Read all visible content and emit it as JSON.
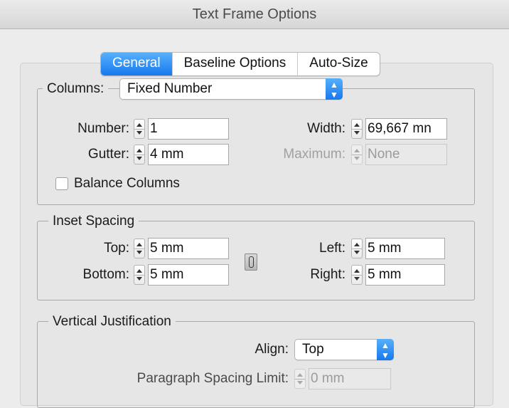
{
  "window": {
    "title": "Text Frame Options"
  },
  "tabs": [
    {
      "label": "General",
      "active": true
    },
    {
      "label": "Baseline Options",
      "active": false
    },
    {
      "label": "Auto-Size",
      "active": false
    }
  ],
  "columns": {
    "legend": "Columns:",
    "type_value": "Fixed Number",
    "number_label": "Number:",
    "number_value": "1",
    "width_label": "Width:",
    "width_value": "69,667 mn",
    "gutter_label": "Gutter:",
    "gutter_value": "4 mm",
    "maximum_label": "Maximum:",
    "maximum_value": "None",
    "balance_label": "Balance Columns"
  },
  "inset": {
    "legend": "Inset Spacing",
    "top_label": "Top:",
    "top_value": "5 mm",
    "bottom_label": "Bottom:",
    "bottom_value": "5 mm",
    "left_label": "Left:",
    "left_value": "5 mm",
    "right_label": "Right:",
    "right_value": "5 mm"
  },
  "vertical": {
    "legend": "Vertical Justification",
    "align_label": "Align:",
    "align_value": "Top",
    "spacing_label": "Paragraph Spacing Limit:",
    "spacing_value": "0 mm"
  },
  "colors": {
    "accent": "#1679f0",
    "accent_light": "#57b0fb",
    "panel_bg": "#e6e6e6",
    "window_bg": "#ececec"
  }
}
